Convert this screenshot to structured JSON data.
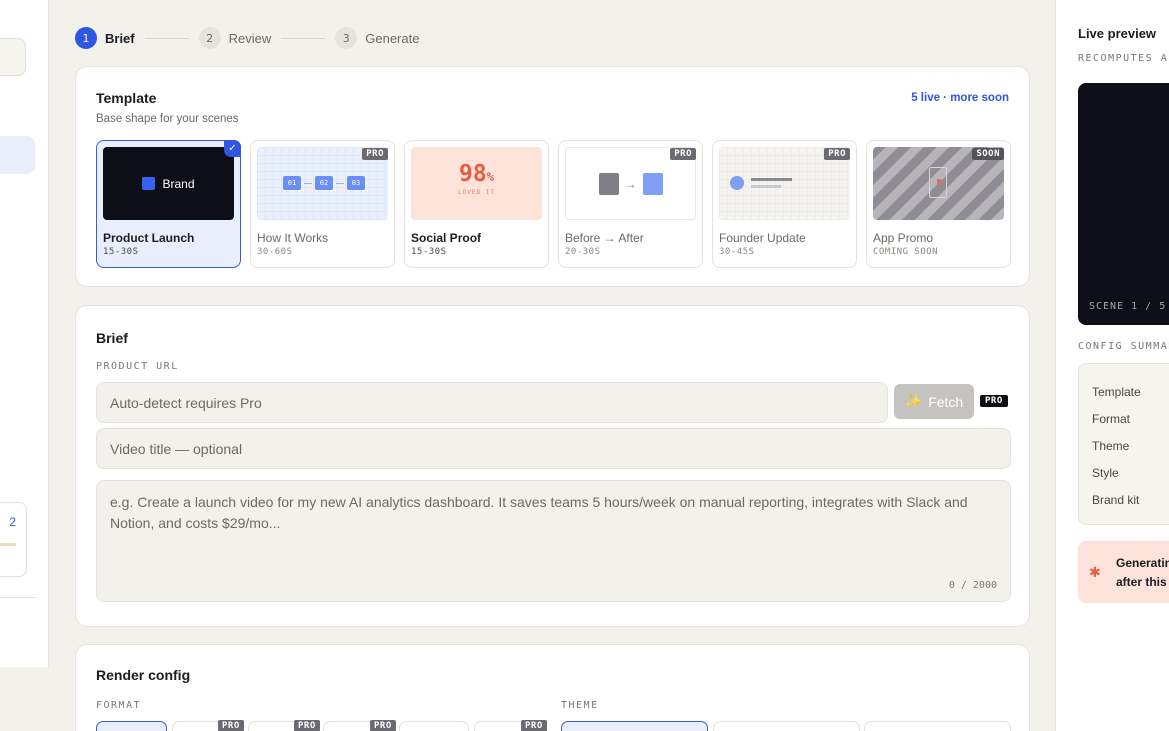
{
  "stepper": {
    "steps": [
      {
        "num": "1",
        "label": "Brief"
      },
      {
        "num": "2",
        "label": "Review"
      },
      {
        "num": "3",
        "label": "Generate"
      }
    ]
  },
  "left_sidebar": {
    "count": "2"
  },
  "template": {
    "title": "Template",
    "subtitle": "Base shape for your scenes",
    "live_badge": "5 live · more soon",
    "items": [
      {
        "name": "Product Launch",
        "duration": "15-30S",
        "thumb_text": "Brand",
        "selected": true
      },
      {
        "name": "How It Works",
        "duration": "30-60S",
        "tag": "PRO",
        "steps": [
          "01",
          "02",
          "03"
        ]
      },
      {
        "name": "Social Proof",
        "duration": "15-30S",
        "stat": "98",
        "stat_unit": "%",
        "stat_caption": "LOVED IT"
      },
      {
        "name": "Before → After",
        "duration": "20-30S",
        "tag": "PRO",
        "arrow": "→"
      },
      {
        "name": "Founder Update",
        "duration": "30-45S",
        "tag": "PRO"
      },
      {
        "name": "App Promo",
        "duration": "COMING SOON",
        "tag": "SOON"
      }
    ]
  },
  "brief": {
    "title": "Brief",
    "url_label": "PRODUCT URL",
    "url_placeholder": "Auto-detect requires Pro",
    "fetch_label": "Fetch",
    "fetch_tag": "PRO",
    "title_placeholder": "Video title — optional",
    "description_placeholder": "e.g. Create a launch video for my new AI analytics dashboard. It saves teams 5 hours/week on manual reporting, integrates with Slack and Notion, and costs $29/mo...",
    "char_count": "0 / 2000"
  },
  "render_config": {
    "title": "Render config",
    "format_label": "FORMAT",
    "theme_label": "THEME",
    "format_tags": [
      "PRO",
      "PRO",
      "PRO",
      "PRO"
    ]
  },
  "preview": {
    "title": "Live preview",
    "subtitle": "RECOMPUTES AS",
    "scene_label": "SCENE 1 / 5",
    "config_label": "CONFIG SUMMAR",
    "summary_rows": [
      "Template",
      "Format",
      "Theme",
      "Style",
      "Brand kit"
    ],
    "warning_line1": "Generatin",
    "warning_line2": "after this"
  },
  "colors": {
    "accent": "#2f55e4",
    "pro_tag": "#6b6a70",
    "warning_bg": "#fde3da"
  }
}
